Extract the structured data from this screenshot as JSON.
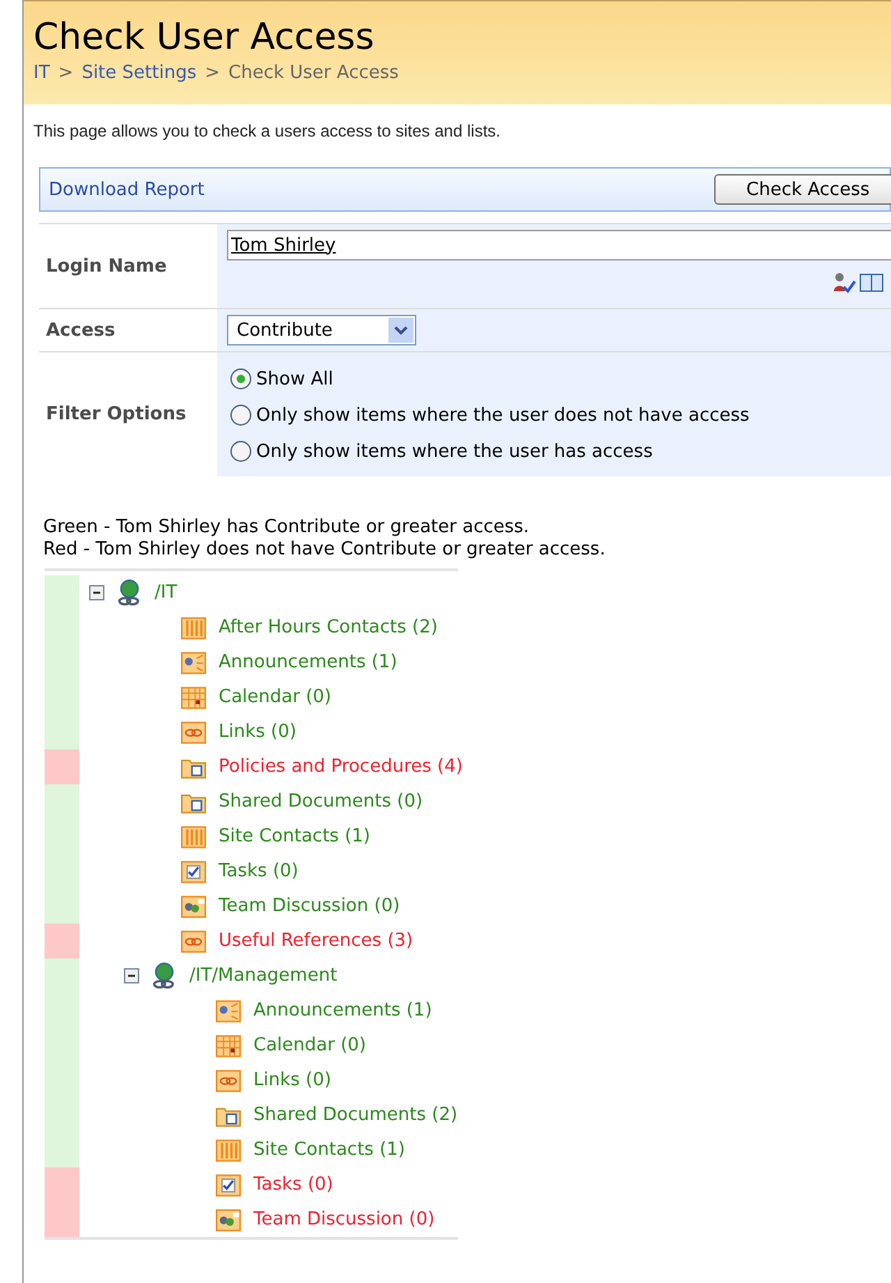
{
  "header": {
    "title": "Check User Access",
    "breadcrumb": [
      {
        "label": "IT",
        "kind": "link"
      },
      {
        "label": "Site Settings",
        "kind": "link"
      },
      {
        "label": "Check User Access",
        "kind": "current"
      }
    ],
    "separator": ">"
  },
  "description": "This page allows you to check a users access to sites and lists.",
  "toolbar": {
    "link": "Download Report",
    "button": "Check Access"
  },
  "form": {
    "login_name": {
      "label": "Login Name",
      "value": "Tom Shirley"
    },
    "access": {
      "label": "Access",
      "value": "Contribute"
    },
    "filter": {
      "label": "Filter Options",
      "options": [
        {
          "label": "Show All",
          "selected": true
        },
        {
          "label": "Only show items where the user does not have access",
          "selected": false
        },
        {
          "label": "Only show items where the user has access",
          "selected": false
        }
      ]
    }
  },
  "legend": [
    "Green - Tom Shirley has Contribute or greater access.",
    "Red - Tom Shirley does not have Contribute or greater access."
  ],
  "tree": [
    {
      "label": "/IT",
      "kind": "site",
      "access": true,
      "expanded": true,
      "children": [
        {
          "label": "After Hours Contacts (2)",
          "kind": "contacts",
          "access": true
        },
        {
          "label": "Announcements (1)",
          "kind": "announcements",
          "access": true
        },
        {
          "label": "Calendar (0)",
          "kind": "calendar",
          "access": true
        },
        {
          "label": "Links (0)",
          "kind": "links",
          "access": true
        },
        {
          "label": "Policies and Procedures (4)",
          "kind": "library",
          "access": false
        },
        {
          "label": "Shared Documents (0)",
          "kind": "library",
          "access": true
        },
        {
          "label": "Site Contacts (1)",
          "kind": "contacts",
          "access": true
        },
        {
          "label": "Tasks (0)",
          "kind": "tasks",
          "access": true
        },
        {
          "label": "Team Discussion (0)",
          "kind": "discussion",
          "access": true
        },
        {
          "label": "Useful References (3)",
          "kind": "links",
          "access": false
        },
        {
          "label": "/IT/Management",
          "kind": "site",
          "access": true,
          "expanded": true,
          "children": [
            {
              "label": "Announcements (1)",
              "kind": "announcements",
              "access": true
            },
            {
              "label": "Calendar (0)",
              "kind": "calendar",
              "access": true
            },
            {
              "label": "Links (0)",
              "kind": "links",
              "access": true
            },
            {
              "label": "Shared Documents (2)",
              "kind": "library",
              "access": true
            },
            {
              "label": "Site Contacts (1)",
              "kind": "contacts",
              "access": true
            },
            {
              "label": "Tasks (0)",
              "kind": "tasks",
              "access": false
            },
            {
              "label": "Team Discussion (0)",
              "kind": "discussion",
              "access": false
            }
          ]
        }
      ]
    }
  ]
}
